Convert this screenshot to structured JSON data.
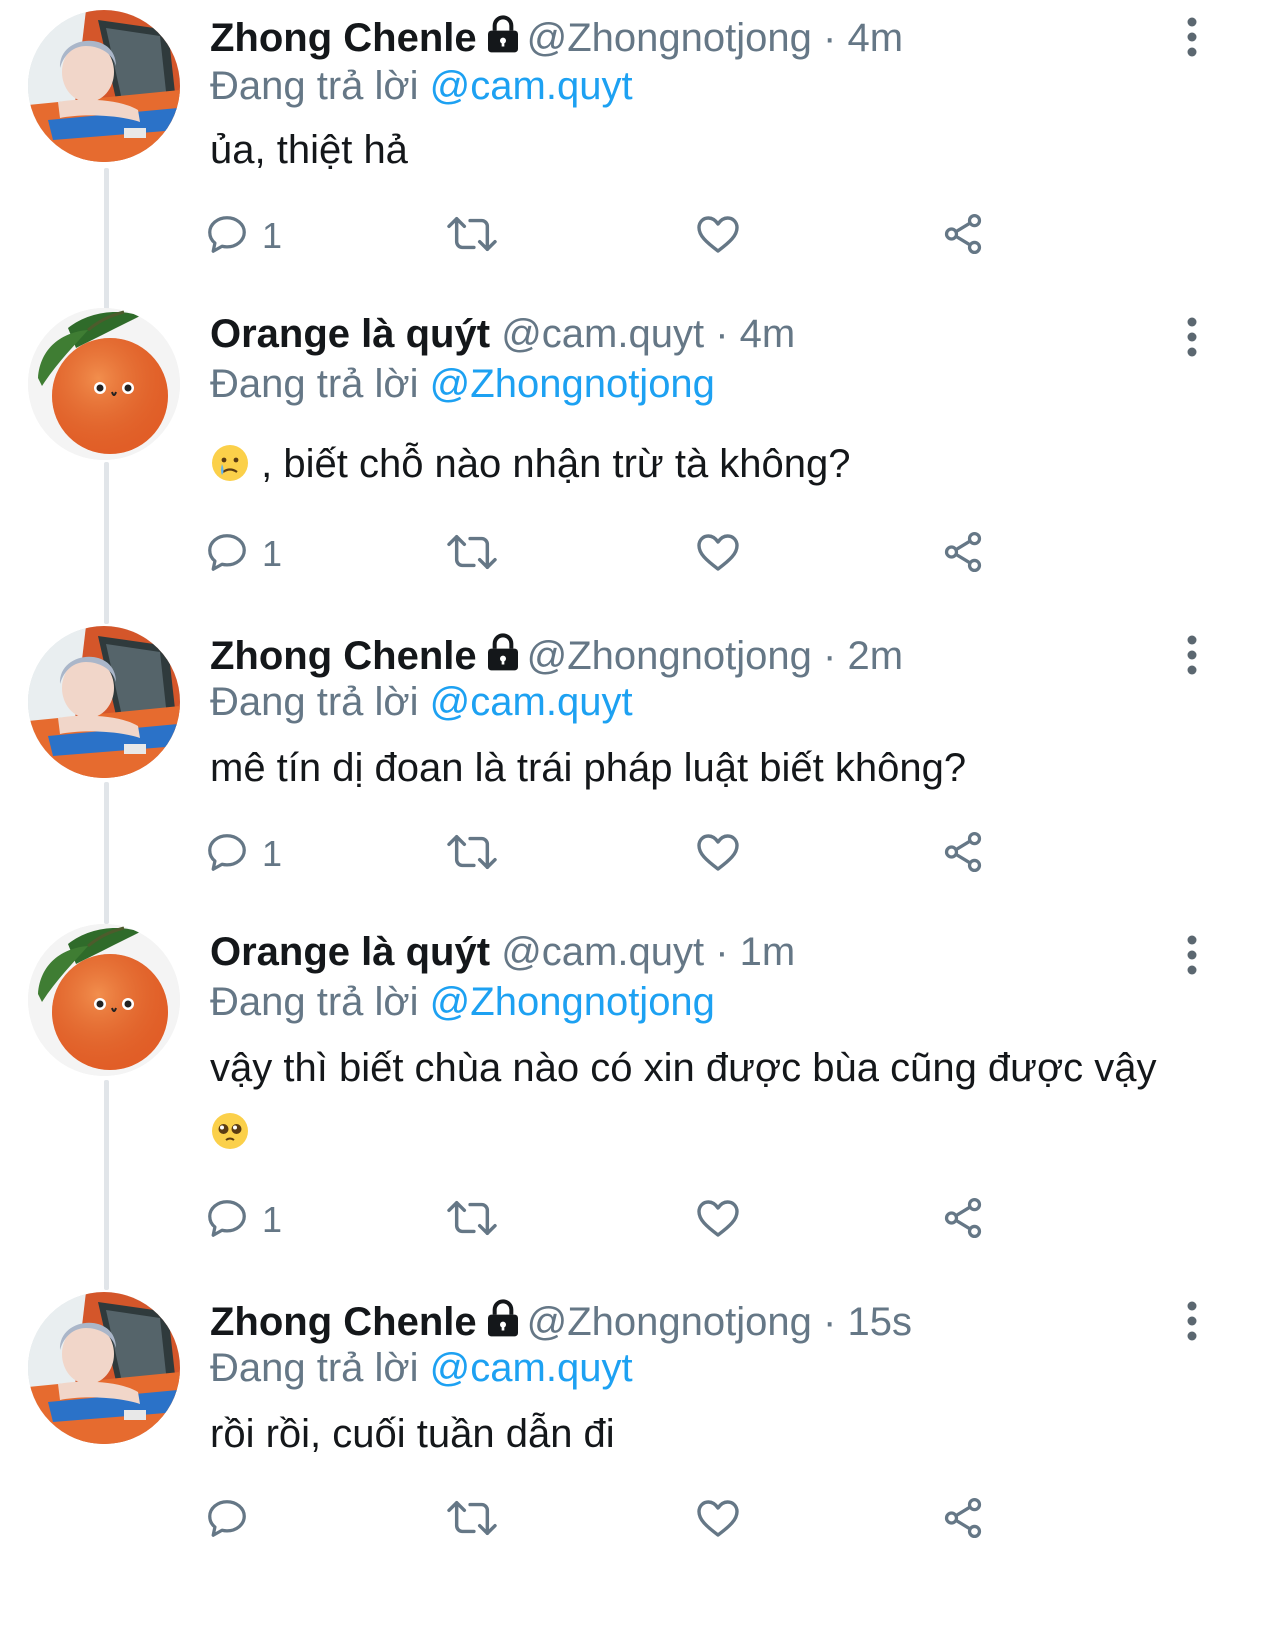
{
  "colors": {
    "name": "#14171a",
    "muted": "#657786",
    "mention": "#1da1f2",
    "thread_line": "#e1e5e9"
  },
  "tweets": [
    {
      "display_name": "Zhong Chenle",
      "protected": true,
      "handle": "@Zhongnotjong",
      "dot": "·",
      "time": "4m",
      "replying_prefix": "Đang trả lời",
      "replying_to": "@cam.quyt",
      "text_before": "ủa, thiệt hả",
      "emoji": "",
      "text_after": "",
      "reply_count": "1",
      "avatar": "chenle-avatar"
    },
    {
      "display_name": "Orange là quýt",
      "protected": false,
      "handle": "@cam.quyt",
      "dot": "·",
      "time": "4m",
      "replying_prefix": "Đang trả lời",
      "replying_to": "@Zhongnotjong",
      "text_before": "",
      "emoji": "crying-face",
      "text_after": " , biết chỗ nào nhận trừ tà không?",
      "reply_count": "1",
      "avatar": "orange-avatar"
    },
    {
      "display_name": "Zhong Chenle",
      "protected": true,
      "handle": "@Zhongnotjong",
      "dot": "·",
      "time": "2m",
      "replying_prefix": "Đang trả lời",
      "replying_to": "@cam.quyt",
      "text_before": "mê tín dị đoan là trái pháp luật biết không?",
      "emoji": "",
      "text_after": "",
      "reply_count": "1",
      "avatar": "chenle-avatar"
    },
    {
      "display_name": "Orange là quýt",
      "protected": false,
      "handle": "@cam.quyt",
      "dot": "·",
      "time": "1m",
      "replying_prefix": "Đang trả lời",
      "replying_to": "@Zhongnotjong",
      "text_before": "vậy thì biết chùa nào có xin được bùa cũng được vậy ",
      "emoji": "pleading-face",
      "text_after": "",
      "reply_count": "1",
      "avatar": "orange-avatar"
    },
    {
      "display_name": "Zhong Chenle",
      "protected": true,
      "handle": "@Zhongnotjong",
      "dot": "·",
      "time": "15s",
      "replying_prefix": "Đang trả lời",
      "replying_to": "@cam.quyt",
      "text_before": "rồi rồi, cuối tuần dẫn đi",
      "emoji": "",
      "text_after": "",
      "reply_count": "",
      "avatar": "chenle-avatar"
    }
  ]
}
